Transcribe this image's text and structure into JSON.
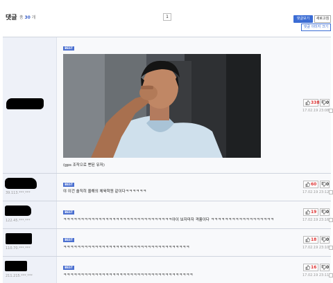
{
  "header": {
    "title": "댓글",
    "total_prefix": "총",
    "total_count": "30",
    "total_suffix": "개",
    "page": "1",
    "view_button": "댓글보기",
    "refresh_button": "새로고침",
    "image_size_button": "댓글 이미지 크기"
  },
  "comments": [
    {
      "best": "BEST",
      "ip": "",
      "text": "(gps 조작으로 뻔된 유저)",
      "has_image": true,
      "up": "338",
      "down": "0",
      "date": "17.02.19 23:08"
    },
    {
      "best": "BEST",
      "ip": "39.113.***.***",
      "text": "야 이건 솔직히 올해의 체육학원 같이다ㅋㅋㅋㅋㅋㅋ",
      "has_image": false,
      "up": "60",
      "down": "0",
      "date": "17.02.19 23:12"
    },
    {
      "best": "BEST",
      "ip": "122.45.***.***",
      "text": "ㅋㅋㅋㅋㅋㅋㅋㅋㅋㅋㅋㅋㅋㅋㅋㅋㅋㅋㅋㅋㅋㅋㅋㅋㅋㅋㅋㅋㅋㅋㅋ아이 보자마자 격휼이다 ㅋㅋㅋㅋㅋㅋㅋㅋㅋㅋㅋㅋㅋㅋㅋㅋㅋㅋ",
      "has_image": false,
      "up": "19",
      "down": "0",
      "date": "17.02.19 23:16"
    },
    {
      "best": "BEST",
      "ip": "110.70.***.***",
      "text": "ㅋㅋㅋㅋㅋㅋㅋㅋㅋㅋㅋㅋㅋㅋㅋㅋㅋㅋㅋㅋㅋㅋㅋㅋㅋㅋㅋㅋㅋㅋㅋㅋㅋㅋㅋㅋ",
      "has_image": false,
      "up": "18",
      "down": "0",
      "date": "17.02.19 23:10"
    },
    {
      "best": "BEST",
      "ip": "211.215.***.***",
      "text": "ㅋㅋㅋㅋㅋㅋㅋㅋㅋㅋㅋㅋㅋㅋㅋㅋㅋㅋㅋㅋㅋㅋㅋㅋㅋㅋㅋㅋㅋㅋㅋㅋㅋㅋㅋㅋㅋ",
      "has_image": false,
      "up": "16",
      "down": "0",
      "date": "17.02.19 23:11"
    }
  ],
  "colors": {
    "accent": "#3b6cd4",
    "upvote": "#dd3333",
    "nick_bg": "#eef1f8",
    "row_bg": "#f8f9fb"
  },
  "icons": [
    "thumbs-up-icon",
    "thumbs-down-icon",
    "report-icon"
  ]
}
